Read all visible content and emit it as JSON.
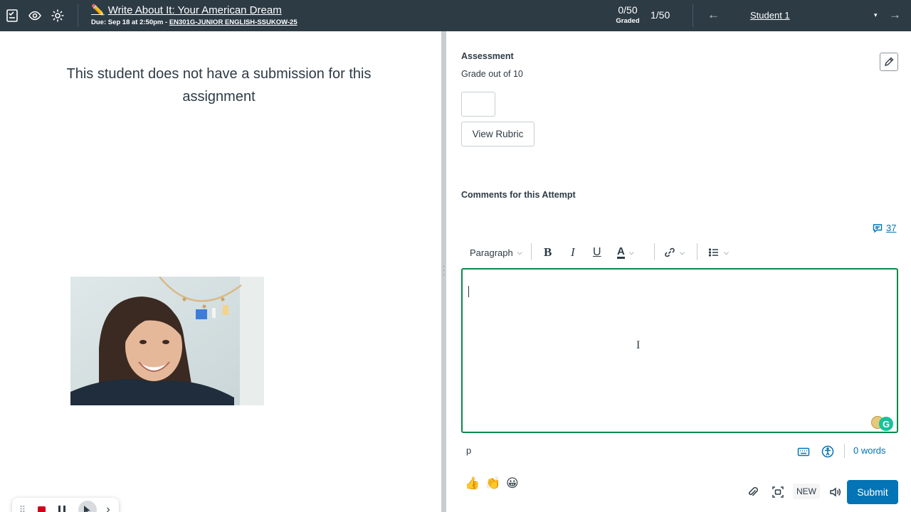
{
  "header": {
    "title": "Write About It: Your American Dream",
    "due_text": "Due: Sep 18 at 2:50pm - ",
    "course": "EN301G-JUNIOR ENGLISH-SSUKOW-25",
    "graded_count": "0/50",
    "graded_label": "Graded",
    "position": "1/50",
    "prev_arrow": "←",
    "next_arrow": "→",
    "student": "Student 1",
    "student_caret": "▾",
    "pencil_glyph": "✏️"
  },
  "left": {
    "no_submission": "This student does not have a submission for this assignment"
  },
  "assessment": {
    "heading": "Assessment",
    "grade_out_of": "Grade out of 10",
    "grade_value": "",
    "view_rubric": "View Rubric"
  },
  "comments": {
    "heading": "Comments for this Attempt",
    "count": "37"
  },
  "toolbar": {
    "paragraph": "Paragraph",
    "bold": "B",
    "italic": "I",
    "underline": "U",
    "text_color": "A",
    "chevron": "⌵"
  },
  "editor": {
    "ibeam": "I",
    "grammarly_letter": "G"
  },
  "status": {
    "element_path": "p",
    "word_count": "0 words"
  },
  "emojis": {
    "thumbs_up": "👍",
    "clap": "👏",
    "smile": "😀"
  },
  "bottom": {
    "new_badge": "NEW",
    "submit": "Submit"
  },
  "recorder": {
    "grip": "⠿",
    "more": "›"
  },
  "colors": {
    "header_bg": "#2d3b45",
    "link_blue": "#0374b5",
    "editor_border": "#0b874b",
    "record_red": "#d0021b"
  }
}
